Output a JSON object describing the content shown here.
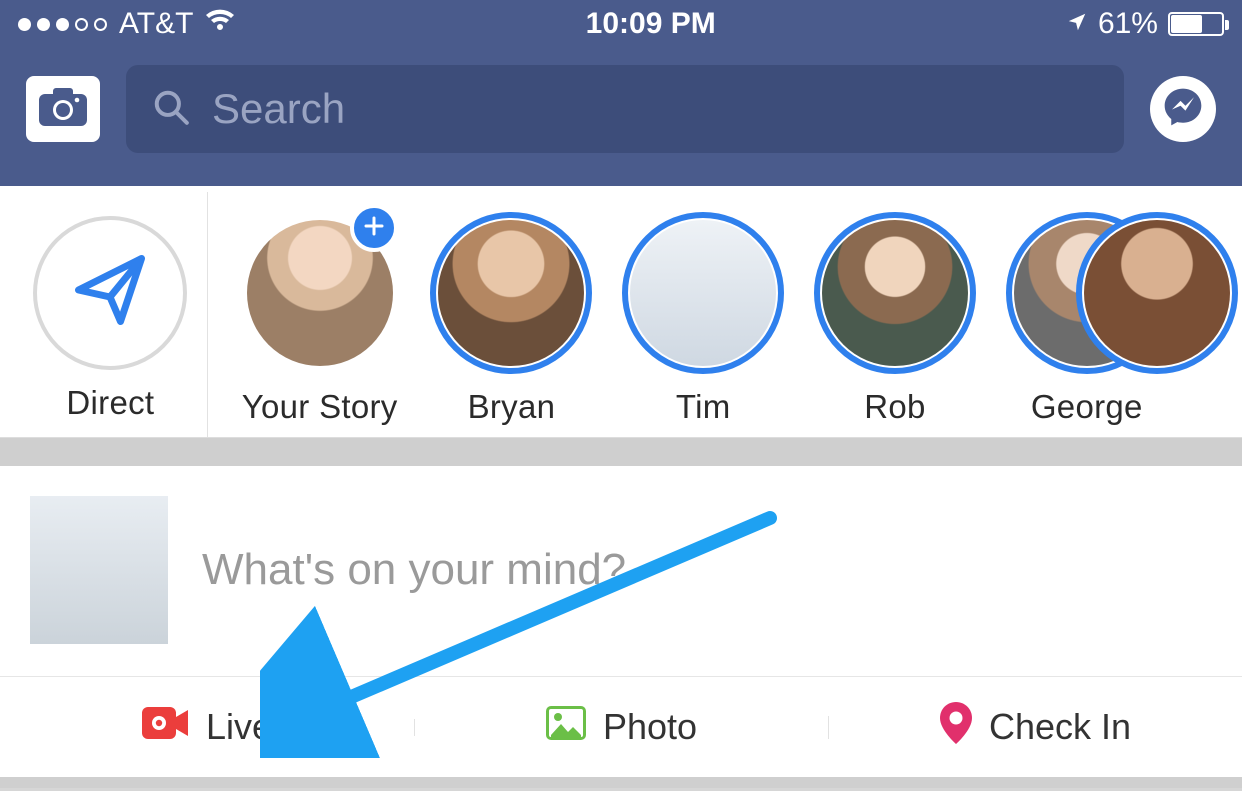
{
  "status": {
    "carrier": "AT&T",
    "time": "10:09 PM",
    "battery": "61%"
  },
  "header": {
    "search_placeholder": "Search"
  },
  "stories": {
    "direct_label": "Direct",
    "items": [
      {
        "label": "Your Story"
      },
      {
        "label": "Bryan"
      },
      {
        "label": "Tim"
      },
      {
        "label": "Rob"
      },
      {
        "label": "George"
      }
    ]
  },
  "composer": {
    "prompt": "What's on your mind?",
    "actions": {
      "live": "Live",
      "photo": "Photo",
      "checkin": "Check In"
    }
  }
}
